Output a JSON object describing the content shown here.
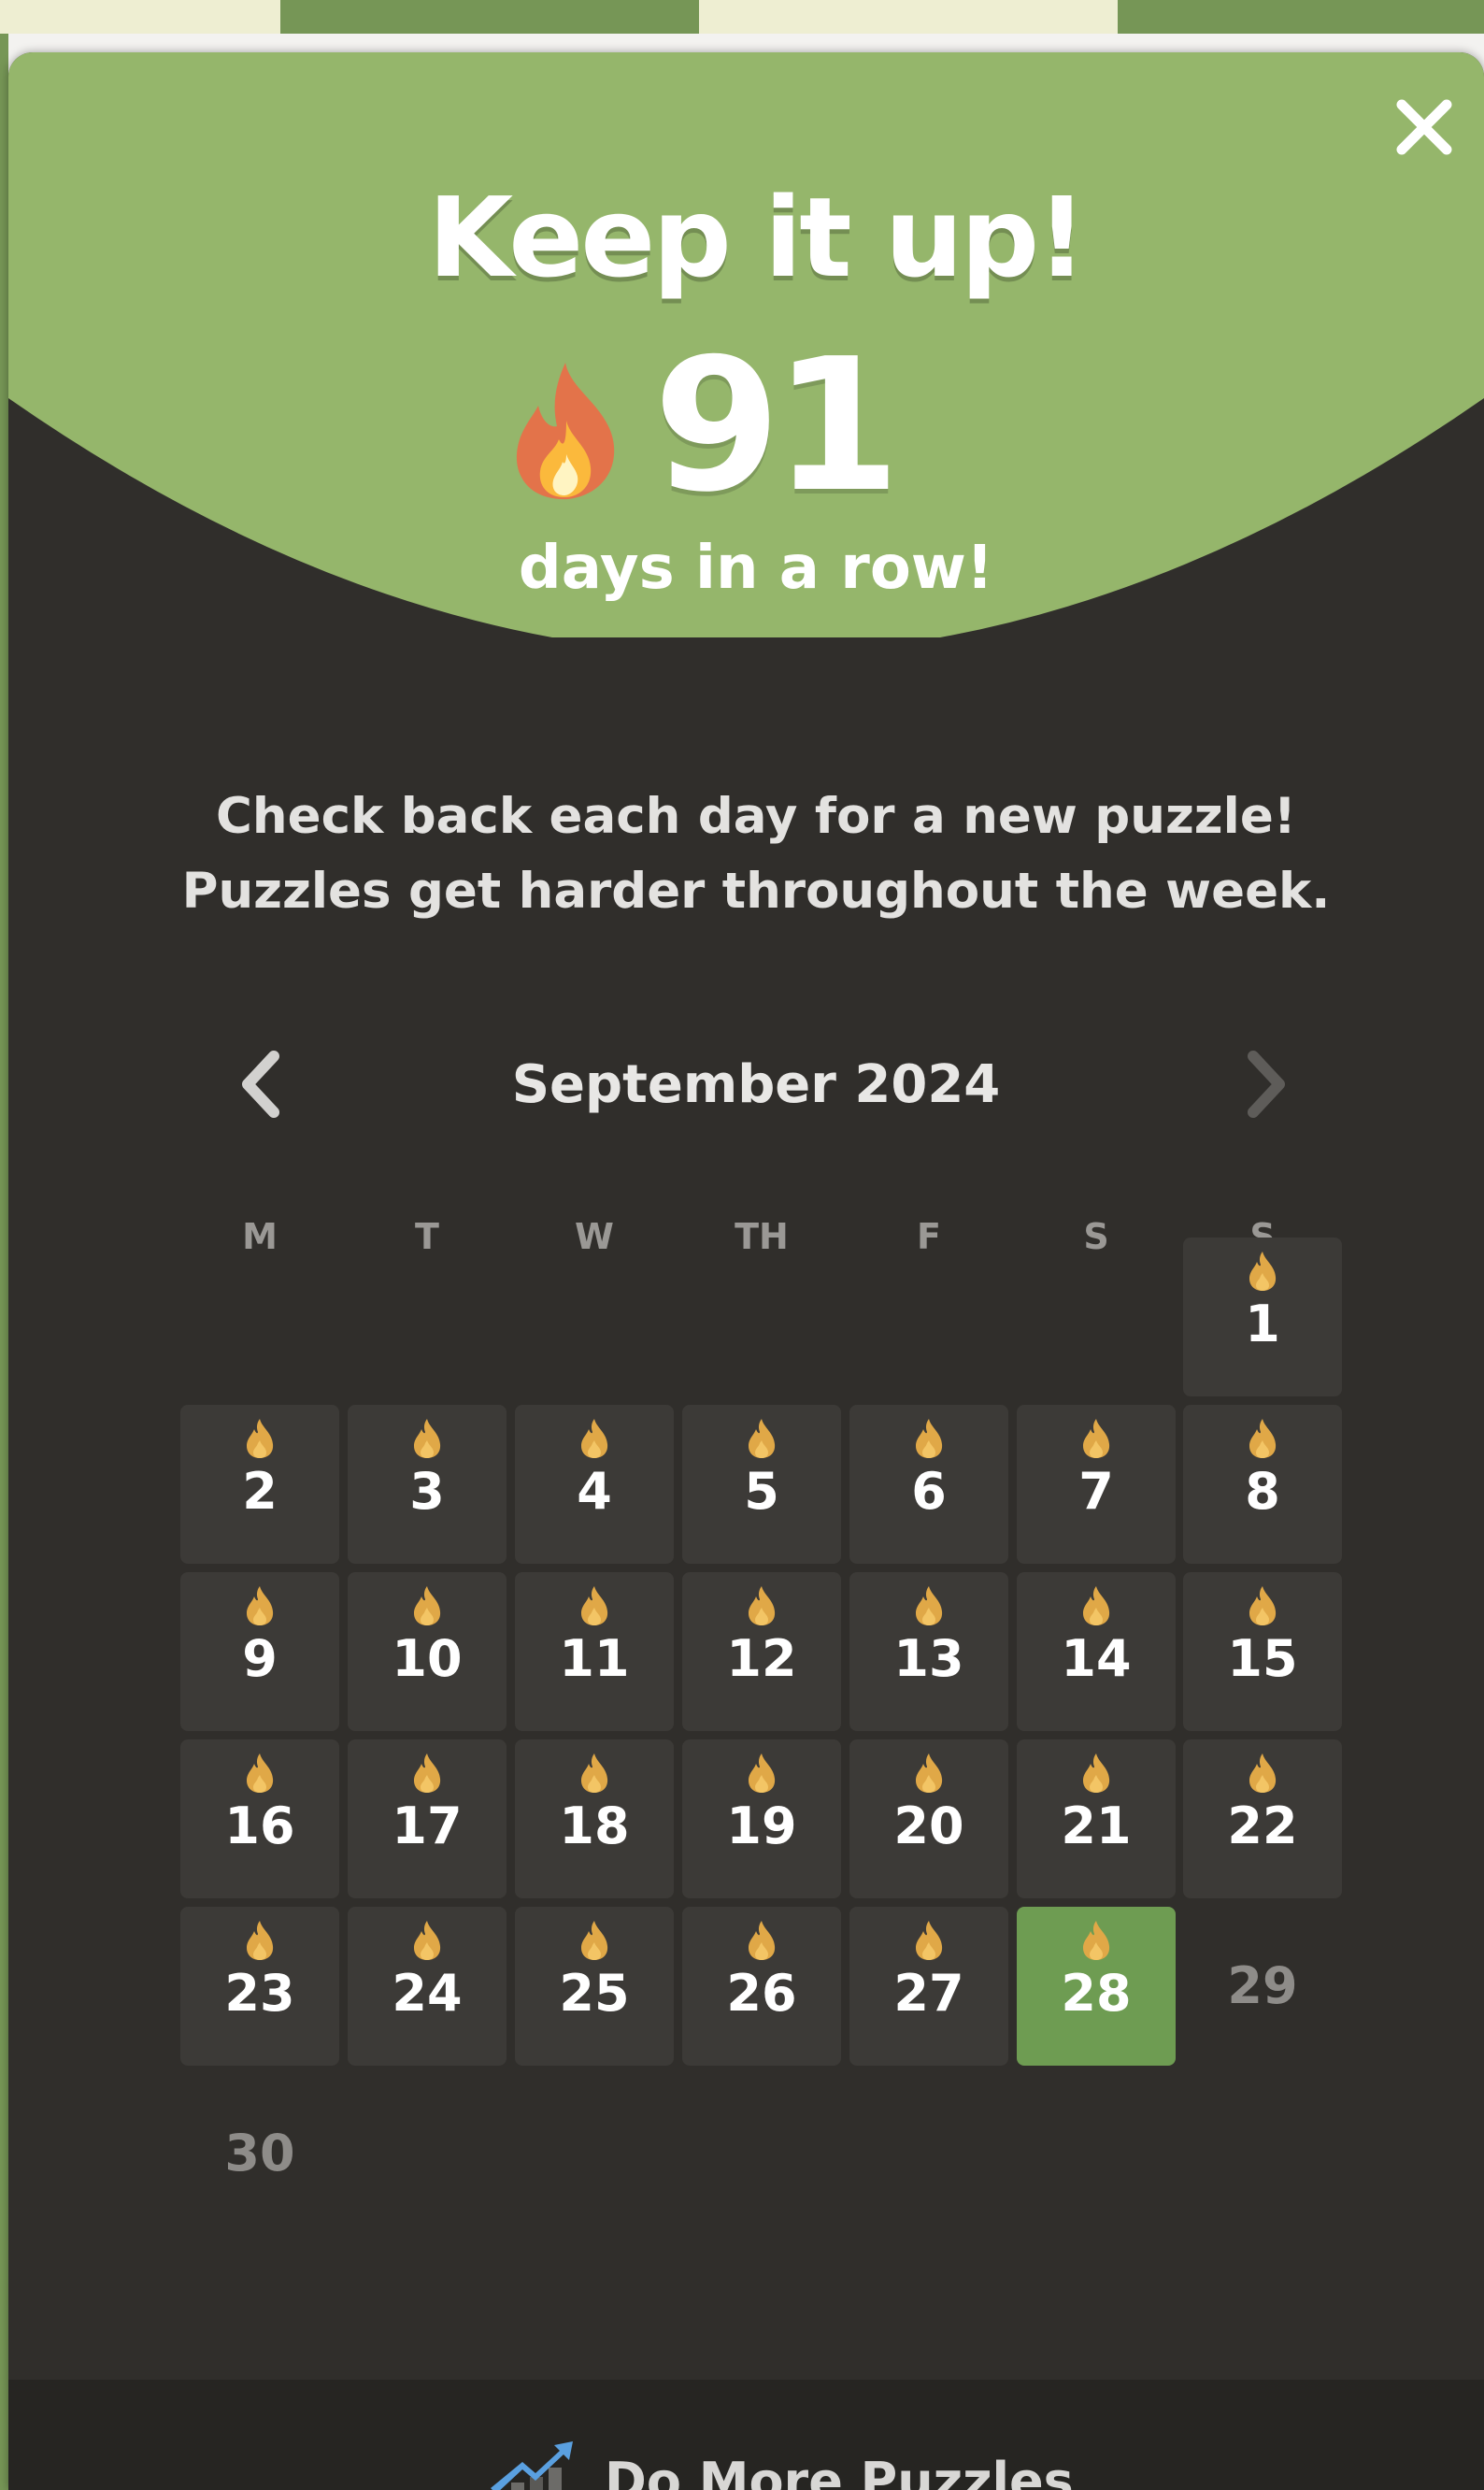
{
  "modal": {
    "title": "Keep it up!",
    "streak_count": "91",
    "streak_label": "days in a row!",
    "info_line1": "Check back each day for a new puzzle!",
    "info_line2": "Puzzles get harder throughout the week.",
    "close_icon": "close-icon"
  },
  "calendar": {
    "month_label": "September 2024",
    "prev_icon": "chevron-left-icon",
    "next_icon": "chevron-right-icon",
    "weekdays": [
      "M",
      "T",
      "W",
      "TH",
      "F",
      "S",
      "S"
    ],
    "first_weekday_index": 6,
    "days": [
      {
        "label": "1",
        "status": "played"
      },
      {
        "label": "2",
        "status": "played"
      },
      {
        "label": "3",
        "status": "played"
      },
      {
        "label": "4",
        "status": "played"
      },
      {
        "label": "5",
        "status": "played"
      },
      {
        "label": "6",
        "status": "played"
      },
      {
        "label": "7",
        "status": "played"
      },
      {
        "label": "8",
        "status": "played"
      },
      {
        "label": "9",
        "status": "played"
      },
      {
        "label": "10",
        "status": "played"
      },
      {
        "label": "11",
        "status": "played"
      },
      {
        "label": "12",
        "status": "played"
      },
      {
        "label": "13",
        "status": "played"
      },
      {
        "label": "14",
        "status": "played"
      },
      {
        "label": "15",
        "status": "played"
      },
      {
        "label": "16",
        "status": "played"
      },
      {
        "label": "17",
        "status": "played"
      },
      {
        "label": "18",
        "status": "played"
      },
      {
        "label": "19",
        "status": "played"
      },
      {
        "label": "20",
        "status": "played"
      },
      {
        "label": "21",
        "status": "played"
      },
      {
        "label": "22",
        "status": "played"
      },
      {
        "label": "23",
        "status": "played"
      },
      {
        "label": "24",
        "status": "played"
      },
      {
        "label": "25",
        "status": "played"
      },
      {
        "label": "26",
        "status": "played"
      },
      {
        "label": "27",
        "status": "played"
      },
      {
        "label": "28",
        "status": "today"
      },
      {
        "label": "29",
        "status": "future"
      },
      {
        "label": "30",
        "status": "future"
      }
    ]
  },
  "footer": {
    "label": "Do More Puzzles",
    "icon": "chart-up-icon"
  },
  "colors": {
    "header_green": "#95b66b",
    "modal_bg": "#302e2b",
    "day_bg": "#3c3a37",
    "today_bg": "#6e9c52",
    "flame_small": "#e0a847",
    "future_text": "#8e8c89"
  }
}
